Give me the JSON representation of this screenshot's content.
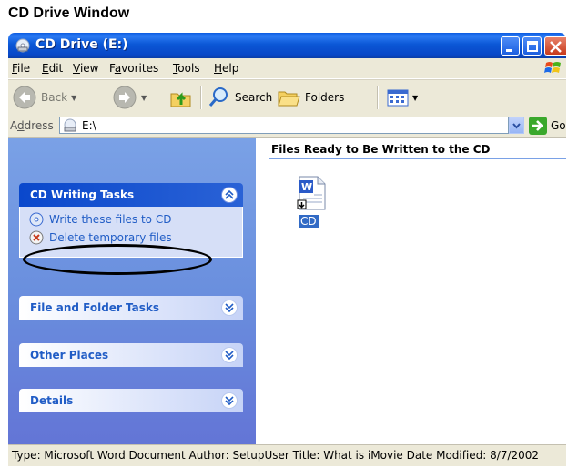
{
  "caption": "CD Drive Window",
  "window": {
    "title": "CD Drive (E:)"
  },
  "menu": [
    {
      "label": "File",
      "u": "F",
      "rest": "ile"
    },
    {
      "label": "Edit",
      "u": "E",
      "rest": "dit"
    },
    {
      "label": "View",
      "u": "V",
      "rest": "iew"
    },
    {
      "label": "Favorites",
      "pre": "F",
      "u": "a",
      "rest": "vorites"
    },
    {
      "label": "Tools",
      "u": "T",
      "rest": "ools"
    },
    {
      "label": "Help",
      "u": "H",
      "rest": "elp"
    }
  ],
  "toolbar": {
    "back_label": "Back",
    "search_label": "Search",
    "folders_label": "Folders"
  },
  "address": {
    "label_pre": "A",
    "label_u": "d",
    "label_rest": "dress",
    "value": "E:\\",
    "go_label": "Go"
  },
  "taskpane": {
    "cd_tasks": {
      "title": "CD Writing Tasks",
      "items": [
        "Write these files to CD",
        "Delete temporary files"
      ]
    },
    "file_folder_title": "File and Folder Tasks",
    "other_places_title": "Other Places",
    "details_title": "Details"
  },
  "files": {
    "header": "Files Ready to Be Written to the CD",
    "items": [
      {
        "name": "CD",
        "icon": "word-document-icon"
      }
    ]
  },
  "status": "Type: Microsoft Word Document Author: SetupUser Title: What is iMovie Date Modified: 8/7/2002",
  "colors": {
    "title_bar": "#0b57d6",
    "task_pane": "#6a8fde",
    "link": "#215dc6",
    "annotation": "#000000"
  }
}
